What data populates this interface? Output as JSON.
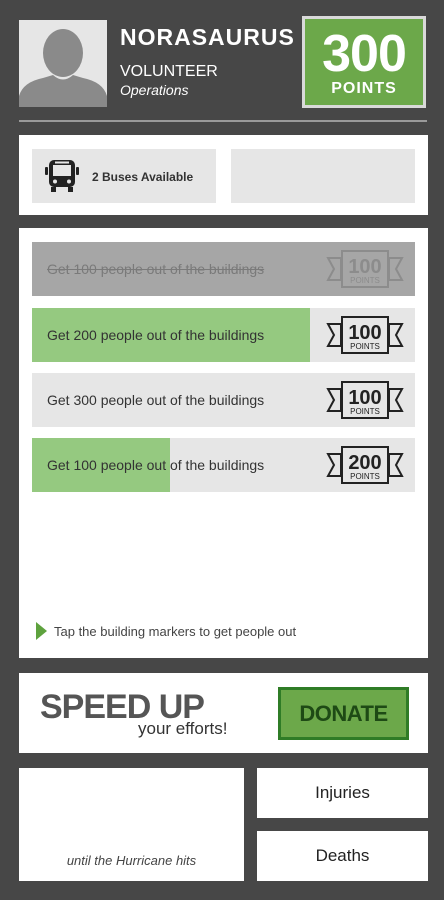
{
  "user": {
    "name": "NORASAURUS",
    "role": "VOLUNTEER",
    "department": "Operations",
    "points": "300",
    "points_label": "POINTS"
  },
  "resources": {
    "bus_text": "2 Buses Available"
  },
  "tasks": [
    {
      "label": "Get 100 people out of the buildings",
      "reward": "100",
      "reward_label": "POINTS",
      "status": "completed",
      "progress": 1.0
    },
    {
      "label": "Get 200 people out of the buildings",
      "reward": "100",
      "reward_label": "POINTS",
      "status": "in-progress",
      "progress": 0.725
    },
    {
      "label": "Get 300 people out of the buildings",
      "reward": "100",
      "reward_label": "POINTS",
      "status": "not-started",
      "progress": 0.0
    },
    {
      "label": "Get 100 people out of the buildings",
      "reward": "200",
      "reward_label": "POINTS",
      "status": "in-progress",
      "progress": 0.36
    }
  ],
  "hint": "Tap the building markers to get people out",
  "promo": {
    "headline": "SPEED UP",
    "subline": "your efforts!",
    "donate_label": "DONATE"
  },
  "countdown": {
    "caption": "until the Hurricane hits"
  },
  "stats": {
    "injuries_label": "Injuries",
    "deaths_label": "Deaths"
  },
  "colors": {
    "background": "#474747",
    "accent_green": "#6ca84a",
    "progress_green": "#95c980",
    "panel": "#ffffff",
    "tile": "#e6e6e6",
    "completed_tile": "#a6a6a6"
  },
  "icons": {
    "avatar": "person-silhouette-icon",
    "bus": "bus-icon",
    "reward": "ribbon-badge-icon",
    "hint": "play-triangle-icon"
  }
}
